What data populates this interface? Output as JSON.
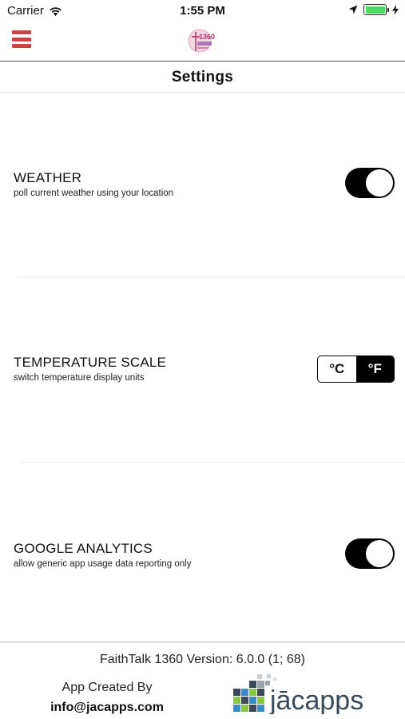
{
  "status_bar": {
    "carrier": "Carrier",
    "time": "1:55 PM",
    "battery_level": 1.0,
    "battery_color": "#4cd964"
  },
  "nav": {
    "menu_icon": "hamburger-menu-icon",
    "menu_color": "#cc4444",
    "logo_text": "1360"
  },
  "page": {
    "title": "Settings"
  },
  "settings": {
    "weather": {
      "title": "WEATHER",
      "subtitle": "poll current weather using your location",
      "enabled": true
    },
    "temperature": {
      "title": "TEMPERATURE SCALE",
      "subtitle": "switch temperature display units",
      "options": [
        "°C",
        "°F"
      ],
      "selected": "°F"
    },
    "analytics": {
      "title": "GOOGLE ANALYTICS",
      "subtitle": "allow generic app usage data reporting only",
      "enabled": true
    }
  },
  "footer": {
    "version": "FaithTalk 1360 Version: 6.0.0 (1; 68)",
    "created_by": "App Created By",
    "email": "info@jacapps.com",
    "brand": "jācapps"
  }
}
